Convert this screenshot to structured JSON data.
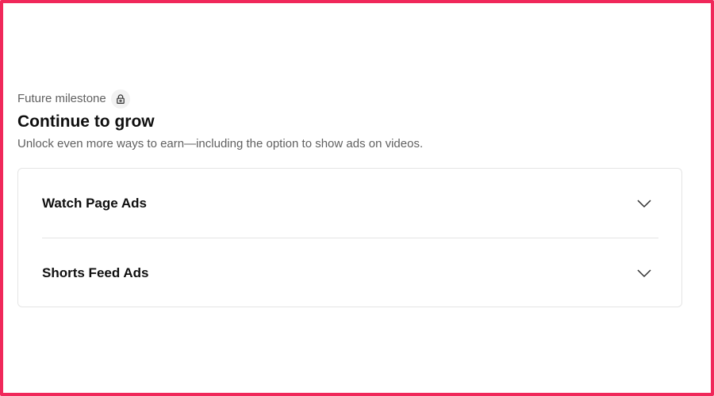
{
  "milestone": {
    "eyebrow": "Future milestone",
    "lock_icon": "lock-icon",
    "title": "Continue to grow",
    "subtitle": "Unlock even more ways to earn—including the option to show ads on videos."
  },
  "accordion": {
    "items": [
      {
        "label": "Watch Page Ads",
        "icon": "chevron-down-icon"
      },
      {
        "label": "Shorts Feed Ads",
        "icon": "chevron-down-icon"
      }
    ]
  },
  "colors": {
    "frame_border": "#f0285a",
    "text_primary": "#0f0f0f",
    "text_secondary": "#606060",
    "divider": "#e5e5e5"
  }
}
